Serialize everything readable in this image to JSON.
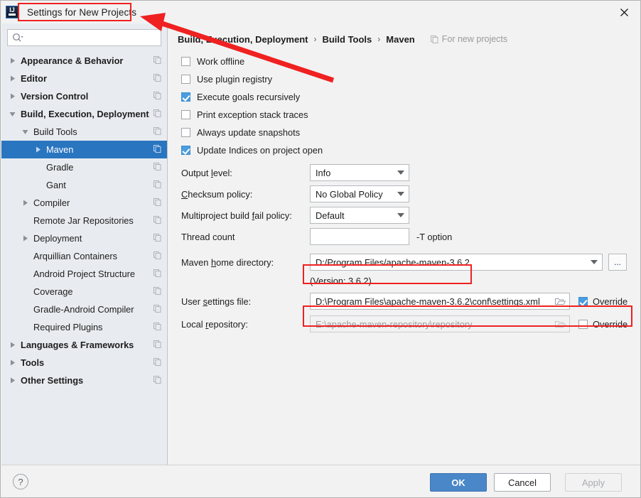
{
  "window": {
    "title": "Settings for New Projects",
    "logo_icon": "intellij-idea-icon",
    "close_icon": "close-icon"
  },
  "sidebar": {
    "search": {
      "placeholder": "",
      "value": "",
      "icon": "search-icon"
    },
    "items": [
      {
        "label": "Appearance & Behavior",
        "indent": 0,
        "twisty": "collapsed",
        "bold": true,
        "copy_icon": true,
        "selected": false
      },
      {
        "label": "Editor",
        "indent": 0,
        "twisty": "collapsed",
        "bold": true,
        "copy_icon": true,
        "selected": false
      },
      {
        "label": "Version Control",
        "indent": 0,
        "twisty": "collapsed",
        "bold": true,
        "copy_icon": true,
        "selected": false
      },
      {
        "label": "Build, Execution, Deployment",
        "indent": 0,
        "twisty": "expanded",
        "bold": true,
        "copy_icon": true,
        "selected": false
      },
      {
        "label": "Build Tools",
        "indent": 1,
        "twisty": "expanded",
        "bold": false,
        "copy_icon": true,
        "selected": false
      },
      {
        "label": "Maven",
        "indent": 2,
        "twisty": "collapsed",
        "bold": false,
        "copy_icon": true,
        "selected": true
      },
      {
        "label": "Gradle",
        "indent": 2,
        "twisty": "none",
        "bold": false,
        "copy_icon": true,
        "selected": false
      },
      {
        "label": "Gant",
        "indent": 2,
        "twisty": "none",
        "bold": false,
        "copy_icon": true,
        "selected": false
      },
      {
        "label": "Compiler",
        "indent": 1,
        "twisty": "collapsed",
        "bold": false,
        "copy_icon": true,
        "selected": false
      },
      {
        "label": "Remote Jar Repositories",
        "indent": 1,
        "twisty": "none",
        "bold": false,
        "copy_icon": true,
        "selected": false
      },
      {
        "label": "Deployment",
        "indent": 1,
        "twisty": "collapsed",
        "bold": false,
        "copy_icon": true,
        "selected": false
      },
      {
        "label": "Arquillian Containers",
        "indent": 1,
        "twisty": "none",
        "bold": false,
        "copy_icon": true,
        "selected": false
      },
      {
        "label": "Android Project Structure",
        "indent": 1,
        "twisty": "none",
        "bold": false,
        "copy_icon": true,
        "selected": false
      },
      {
        "label": "Coverage",
        "indent": 1,
        "twisty": "none",
        "bold": false,
        "copy_icon": true,
        "selected": false
      },
      {
        "label": "Gradle-Android Compiler",
        "indent": 1,
        "twisty": "none",
        "bold": false,
        "copy_icon": true,
        "selected": false
      },
      {
        "label": "Required Plugins",
        "indent": 1,
        "twisty": "none",
        "bold": false,
        "copy_icon": true,
        "selected": false
      },
      {
        "label": "Languages & Frameworks",
        "indent": 0,
        "twisty": "collapsed",
        "bold": true,
        "copy_icon": true,
        "selected": false
      },
      {
        "label": "Tools",
        "indent": 0,
        "twisty": "collapsed",
        "bold": true,
        "copy_icon": true,
        "selected": false
      },
      {
        "label": "Other Settings",
        "indent": 0,
        "twisty": "collapsed",
        "bold": true,
        "copy_icon": true,
        "selected": false
      }
    ]
  },
  "main": {
    "breadcrumb": {
      "part1": "Build, Execution, Deployment",
      "sep1": "›",
      "part2": "Build Tools",
      "sep2": "›",
      "part3": "Maven"
    },
    "for_new_projects": {
      "label": "For new projects",
      "icon": "copy-icon"
    },
    "checkboxes": [
      {
        "label": "Work offline",
        "mnemonic": "ffl",
        "checked": false
      },
      {
        "label": "Use plugin registry",
        "mnemonic": "r",
        "checked": false
      },
      {
        "label": "Execute goals recursively",
        "mnemonic": "g",
        "checked": true
      },
      {
        "label": "Print exception stack traces",
        "mnemonic": "e",
        "checked": false
      },
      {
        "label": "Always update snapshots",
        "mnemonic": "s",
        "checked": false
      },
      {
        "label": "Update Indices on project open",
        "mnemonic": "",
        "checked": true
      }
    ],
    "output_level": {
      "label": "Output level:",
      "value": "Info"
    },
    "checksum_policy": {
      "label": "Checksum policy:",
      "value": "No Global Policy"
    },
    "fail_policy": {
      "label": "Multiproject build fail policy:",
      "value": "Default"
    },
    "thread_count": {
      "label": "Thread count",
      "value": "",
      "suffix": "-T option"
    },
    "maven_home": {
      "label": "Maven home directory:",
      "value": "D:/Program Files/apache-maven-3.6.2",
      "dots_label": "...",
      "highlighted": true
    },
    "version_note": "(Version: 3.6.2)",
    "user_settings": {
      "label": "User settings file:",
      "value": "D:\\Program Files\\apache-maven-3.6.2\\conf\\settings.xml",
      "browse_icon": "folder-icon",
      "override_label": "Override",
      "override_checked": true,
      "highlighted": true
    },
    "local_repository": {
      "label": "Local repository:",
      "value": "E:\\apache-maven-repository\\repository",
      "browse_icon": "folder-icon",
      "override_label": "Override",
      "override_checked": false,
      "disabled": true
    }
  },
  "footer": {
    "help_label": "?",
    "ok_label": "OK",
    "cancel_label": "Cancel",
    "apply_label": "Apply"
  },
  "annotations": {
    "color": "#ef2121",
    "arrow": "points-to-window-title"
  },
  "colors": {
    "selection_blue": "#2a75c0",
    "checkbox_blue": "#4a9de0",
    "ok_blue": "#4a87c8",
    "annotation_red": "#ef2121",
    "sidebar_bg": "#e8ecf0",
    "panel_bg": "#f2f2f2"
  }
}
